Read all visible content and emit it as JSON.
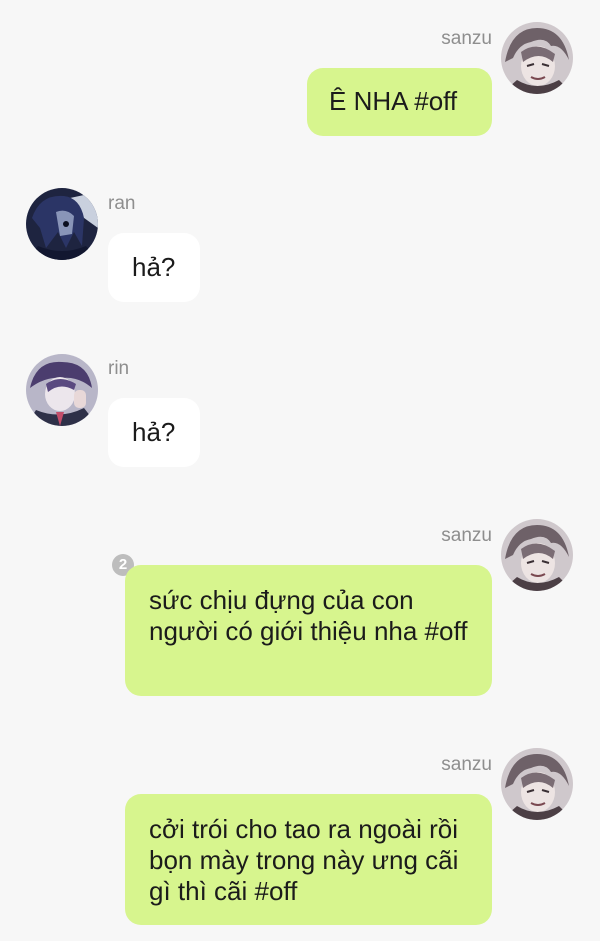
{
  "messages": [
    {
      "sender": "sanzu",
      "side": "right",
      "text": "Ê NHA #off"
    },
    {
      "sender": "ran",
      "side": "left",
      "text": "hả?"
    },
    {
      "sender": "rin",
      "side": "left",
      "text": "hả?"
    },
    {
      "sender": "sanzu",
      "side": "right",
      "read_count": "2",
      "text": "sức chịu đựng của con người có giới thiệu nha #off"
    },
    {
      "sender": "sanzu",
      "side": "right",
      "text": "cởi trói cho tao ra ngoài rồi bọn mày trong này ưng cãi gì thì cãi #off"
    }
  ],
  "colors": {
    "background": "#f7f7f7",
    "outgoing_bubble": "#d7f58e",
    "incoming_bubble": "#ffffff",
    "sender_name": "#8e8e8e"
  }
}
